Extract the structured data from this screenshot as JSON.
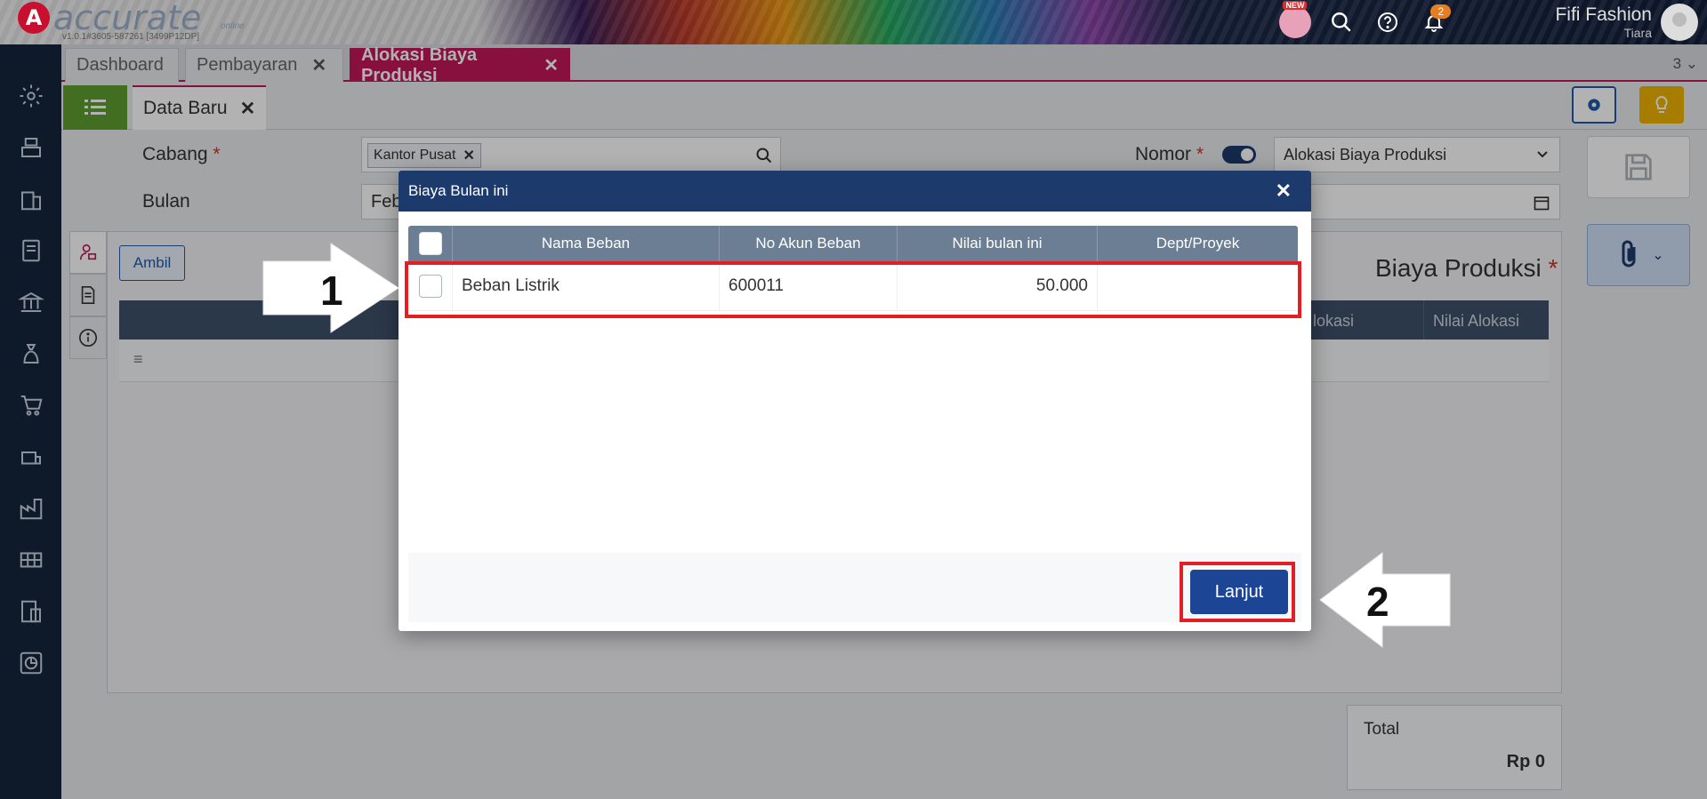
{
  "header": {
    "logo_text": "accurate",
    "logo_sub": "online",
    "version": "v1.0.1#3605-587261 [3499P12DP]",
    "new_badge": "NEW",
    "notification_count": "2",
    "user_name": "Fifi Fashion",
    "user_sub": "Tiara"
  },
  "tabs": [
    {
      "label": "Dashboard"
    },
    {
      "label": "Pembayaran"
    },
    {
      "label": "Alokasi Biaya Produksi"
    }
  ],
  "tab_count": "3",
  "subtab": {
    "label": "Data Baru"
  },
  "form": {
    "cabang_label": "Cabang",
    "cabang_value": "Kantor Pusat",
    "bulan_label": "Bulan",
    "bulan_value": "Feb",
    "nomor_label": "Nomor",
    "nomor_value": "Alokasi Biaya Produksi",
    "required_mark": "*"
  },
  "panel": {
    "ambil_label": "Ambil",
    "title": "Biaya Produksi",
    "col_alokasi": "lokasi",
    "col_nilai_alokasi": "Nilai Alokasi"
  },
  "total": {
    "label": "Total",
    "value": "Rp 0"
  },
  "modal": {
    "title": "Biaya Bulan ini",
    "close": "✕",
    "columns": [
      "Nama Beban",
      "No Akun Beban",
      "Nilai bulan ini",
      "Dept/Proyek"
    ],
    "rows": [
      {
        "nama": "Beban Listrik",
        "akun": "600011",
        "nilai": "50.000",
        "dept": ""
      }
    ],
    "next_label": "Lanjut"
  },
  "annotations": {
    "step1": "1",
    "step2": "2"
  },
  "colors": {
    "accent": "#c2185b",
    "navy": "#1c3a6b",
    "highlight": "#e31e24"
  }
}
